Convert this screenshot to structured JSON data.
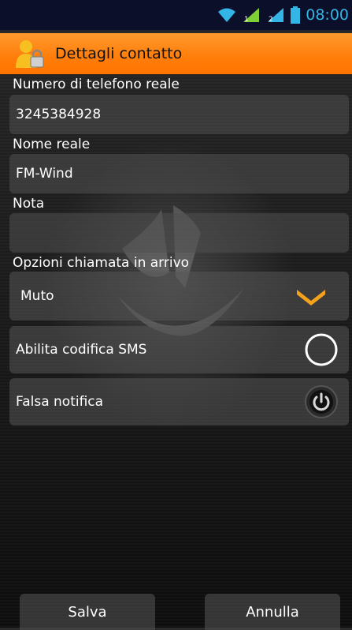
{
  "status": {
    "time": "08:00",
    "icons": [
      "wifi-icon",
      "signal-sim1-icon",
      "signal-sim2-icon",
      "battery-icon"
    ]
  },
  "header": {
    "title": "Dettagli contatto",
    "icon": "contact-lock-icon",
    "color": "#ff7d0a"
  },
  "form": {
    "phone_label": "Numero di telefono reale",
    "phone_value": "3245384928",
    "name_label": "Nome reale",
    "name_value": "FM-Wind",
    "note_label": "Nota",
    "note_value": "",
    "call_options_label": "Opzioni chiamata in arrivo",
    "call_options_value": "Muto"
  },
  "toggles": {
    "sms_label": "Abilita codifica SMS",
    "sms_icon": "radio-off-icon",
    "fake_label": "Falsa notifica",
    "fake_icon": "power-icon"
  },
  "buttons": {
    "save": "Salva",
    "cancel": "Annulla"
  },
  "accent": "#f4a21c"
}
